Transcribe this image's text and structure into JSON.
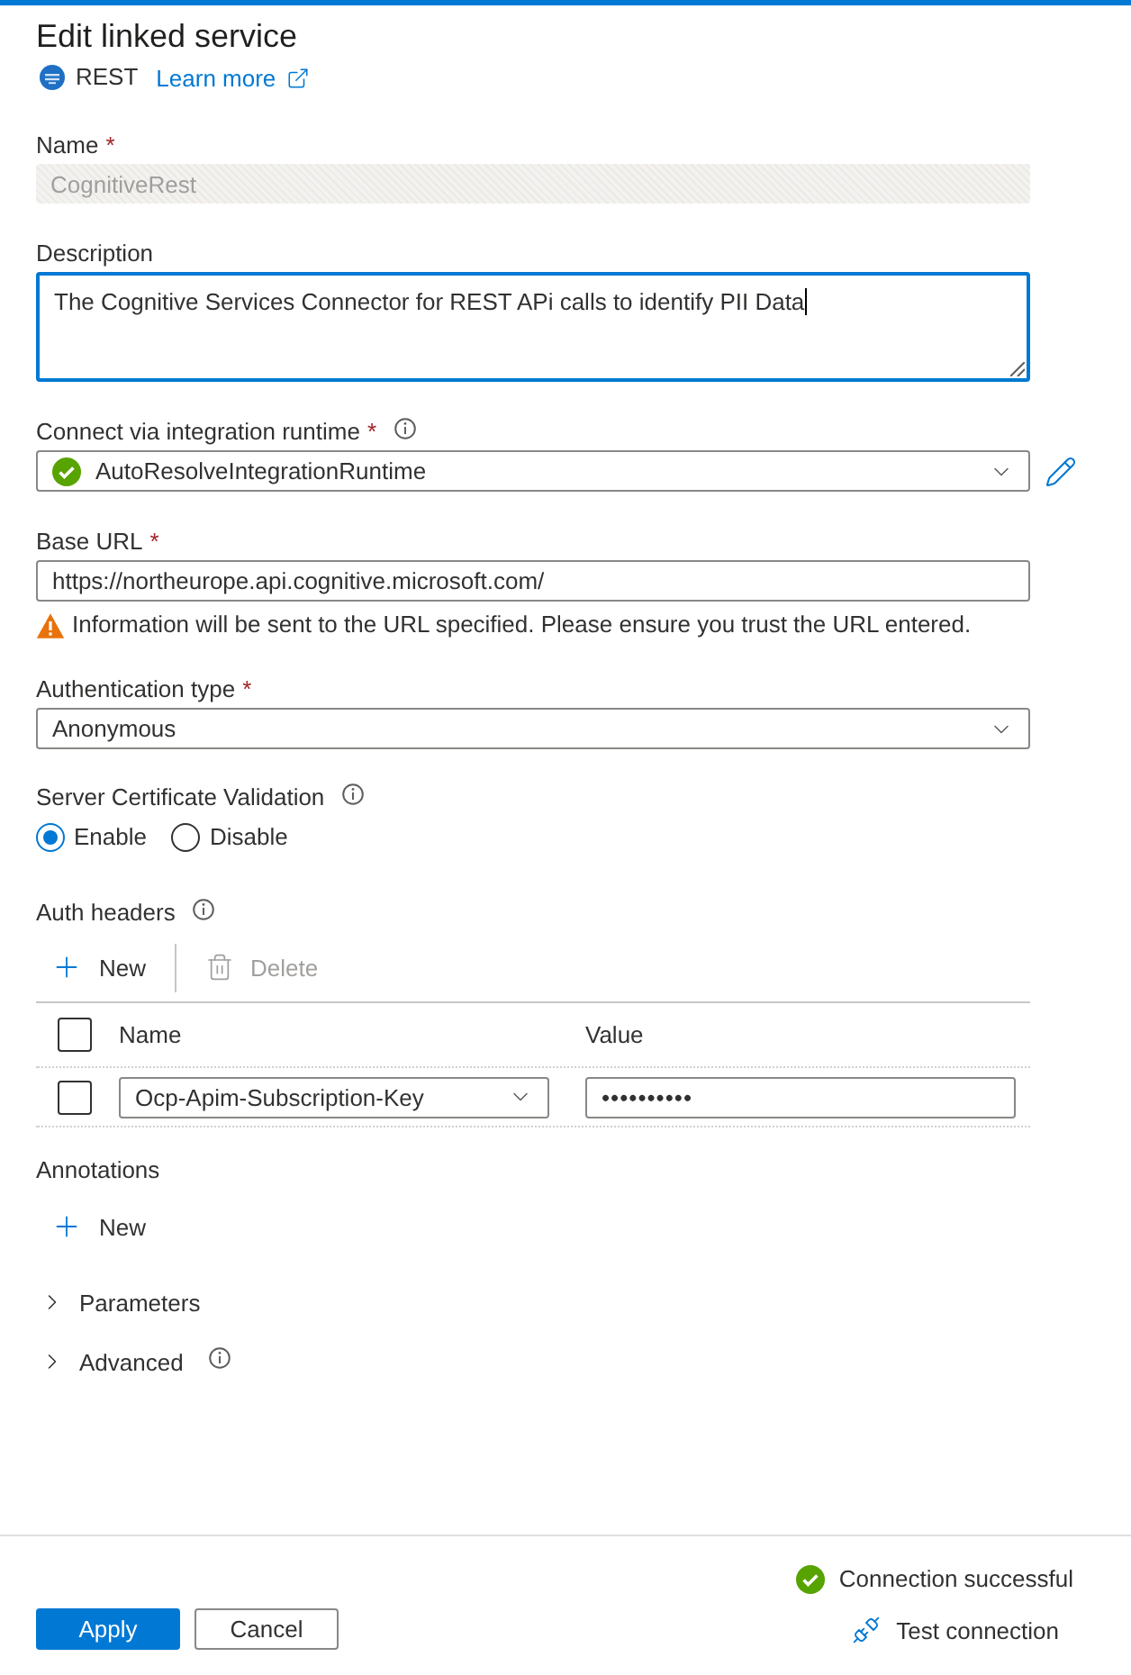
{
  "header": {
    "title": "Edit linked service",
    "service": "REST",
    "learn_more": "Learn more"
  },
  "fields": [
    {
      "kind": "text",
      "label": "Name",
      "required_mark": "*",
      "value": "CognitiveRest",
      "disabled": true
    },
    {
      "kind": "textarea",
      "label": "Description",
      "value": "The Cognitive Services Connector for REST APi calls to identify PII Data",
      "focused": true
    },
    {
      "kind": "select",
      "label": "Connect via integration runtime",
      "required_mark": "*",
      "info": true,
      "value": "AutoResolveIntegrationRuntime",
      "healthy": true,
      "editable": true
    },
    {
      "kind": "text",
      "label": "Base URL",
      "required_mark": "*",
      "value": "https://northeurope.api.cognitive.microsoft.com/",
      "disabled": false,
      "warning": "Information will be sent to the URL specified. Please ensure you trust the URL entered."
    },
    {
      "kind": "select",
      "label": "Authentication type",
      "required_mark": "*",
      "value": "Anonymous"
    },
    {
      "kind": "radio",
      "label": "Server Certificate Validation",
      "info": true,
      "options": [
        {
          "label": "Enable",
          "selected": true
        },
        {
          "label": "Disable",
          "selected": false
        }
      ]
    }
  ],
  "auth_headers": {
    "label": "Auth headers",
    "info": true,
    "toolbar": [
      {
        "kind": "add",
        "label": "New",
        "disabled": false
      },
      {
        "kind": "delete",
        "label": "Delete",
        "disabled": true
      }
    ],
    "select_all_checked": false,
    "columns": [
      "Name",
      "Value"
    ],
    "rows": [
      {
        "checked": false,
        "name": "Ocp-Apim-Subscription-Key",
        "value": "••••••••••"
      }
    ]
  },
  "annotations": {
    "label": "Annotations",
    "new_button": "New"
  },
  "sections": [
    {
      "label": "Parameters",
      "expanded": false,
      "info": false
    },
    {
      "label": "Advanced",
      "expanded": false,
      "info": true
    }
  ],
  "footer": {
    "succeeded": true,
    "status_text": "Connection successful",
    "test_connection": "Test connection",
    "buttons": [
      {
        "kind": "primary",
        "label": "Apply"
      },
      {
        "kind": "default",
        "label": "Cancel"
      }
    ]
  }
}
